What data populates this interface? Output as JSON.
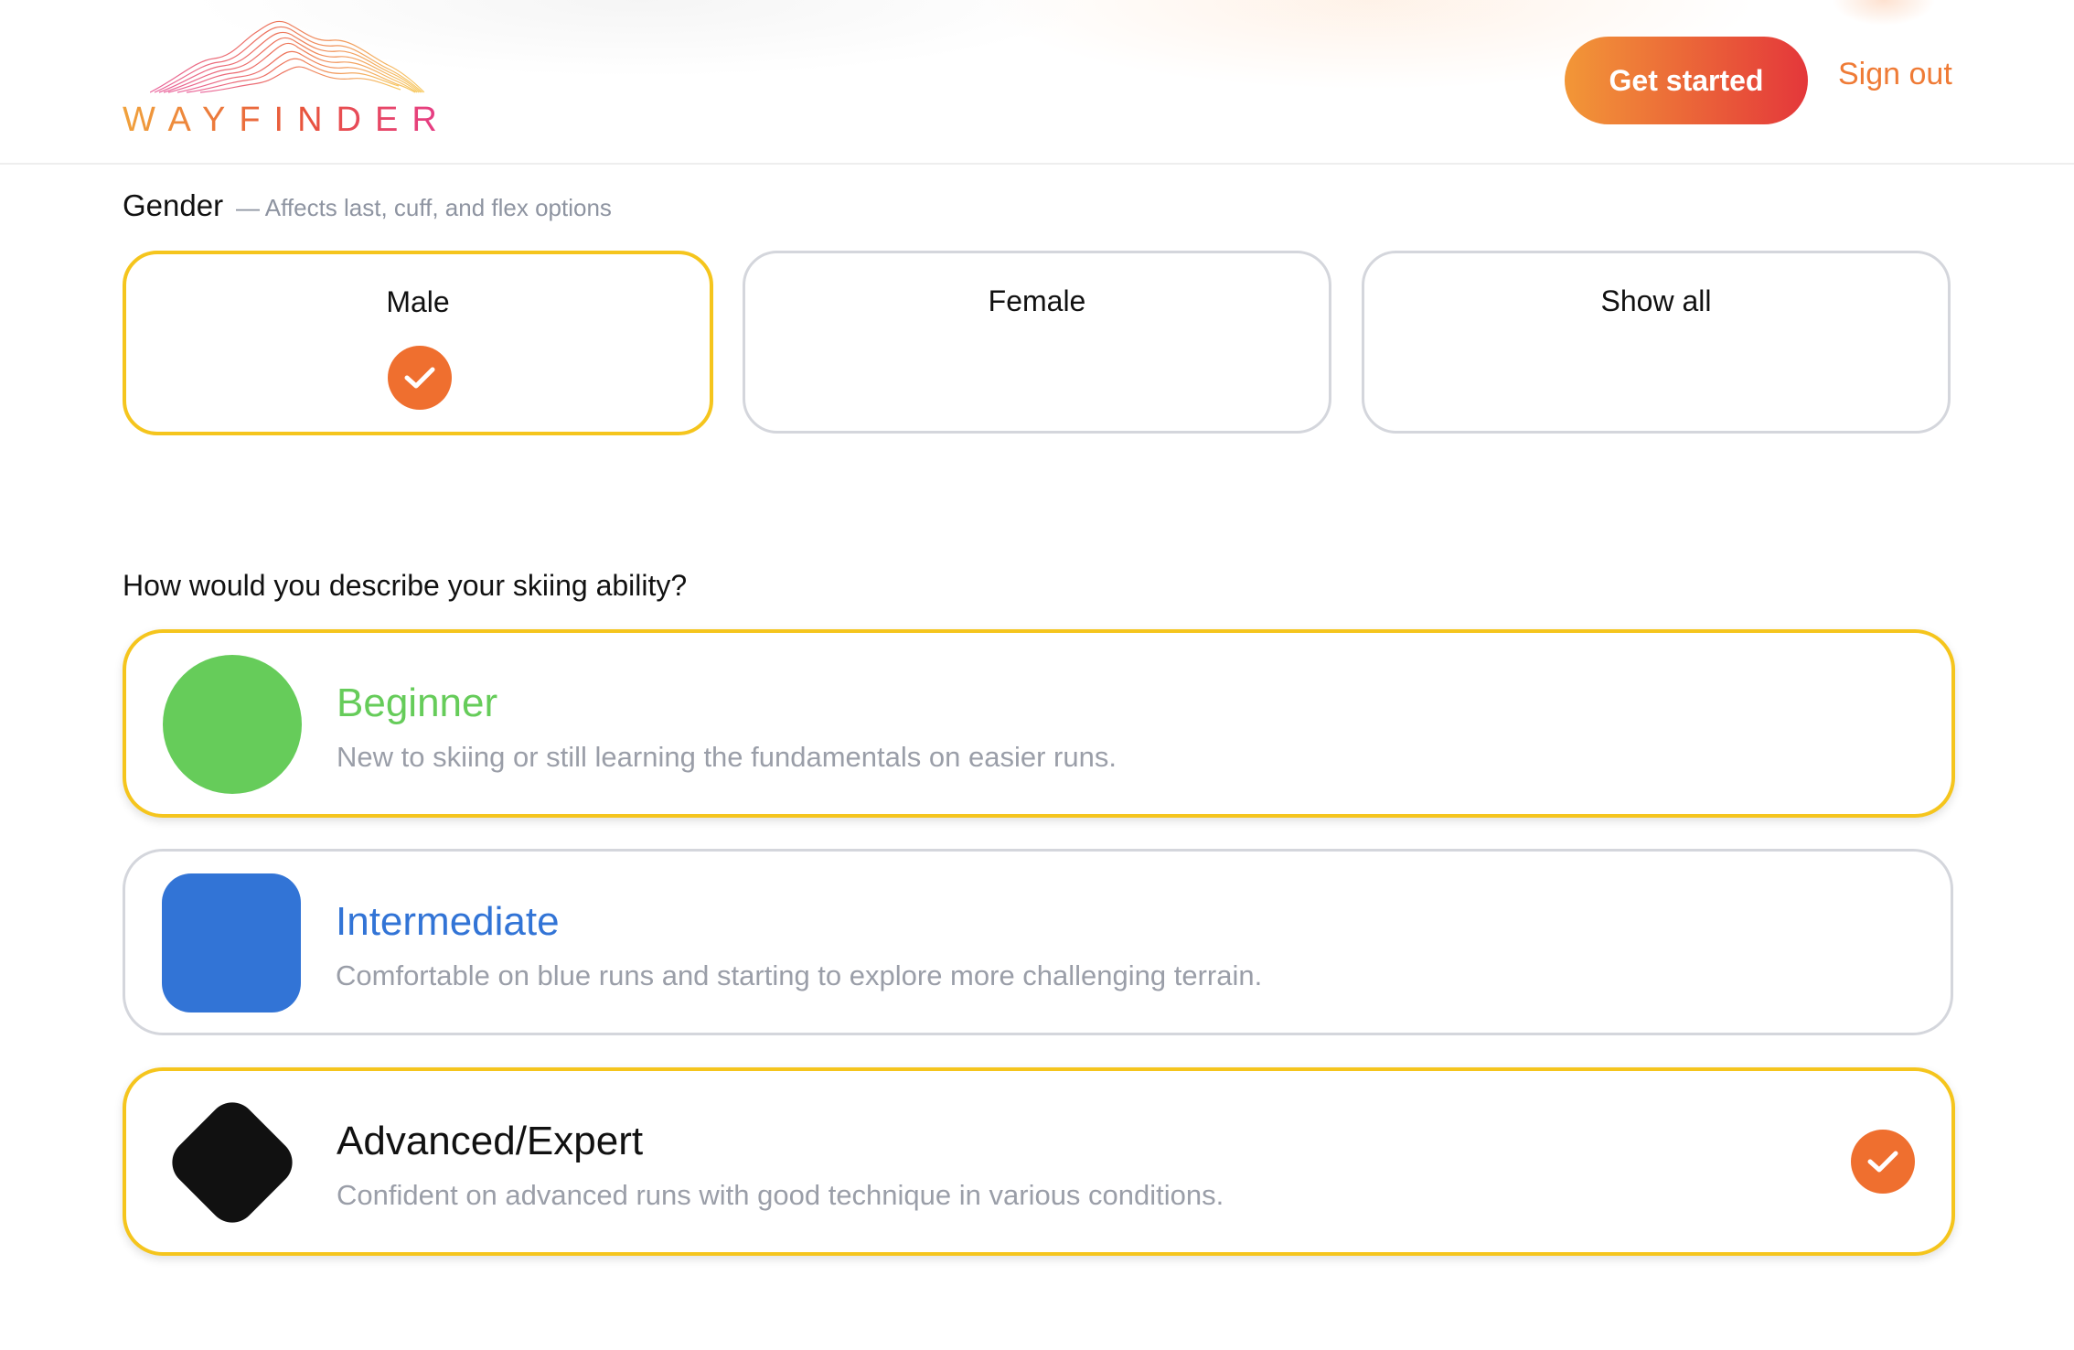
{
  "brand": {
    "name": "WAYFINDER"
  },
  "header": {
    "get_started_label": "Get started",
    "sign_out_label": "Sign out"
  },
  "gender": {
    "title": "Gender",
    "hint": "— Affects last, cuff, and flex options",
    "options": [
      {
        "label": "Male",
        "selected": true
      },
      {
        "label": "Female",
        "selected": false
      },
      {
        "label": "Show all",
        "selected": false
      }
    ]
  },
  "ability": {
    "question": "How would you describe your skiing ability?",
    "options": [
      {
        "title": "Beginner",
        "description": "New to skiing or still learning the fundamentals on easier runs.",
        "color": "#66cc5a",
        "icon": "green-circle-icon",
        "selected": false
      },
      {
        "title": "Intermediate",
        "description": "Comfortable on blue runs and starting to explore more challenging terrain.",
        "color": "#3274d6",
        "icon": "blue-square-icon",
        "selected": false
      },
      {
        "title": "Advanced/Expert",
        "description": "Confident on advanced runs with good technique in various conditions.",
        "color": "#111111",
        "icon": "black-diamond-icon",
        "selected": true
      }
    ]
  },
  "colors": {
    "accent": "#ef6f2f",
    "selected_border": "#f5c51d",
    "link": "#ef7b36"
  }
}
